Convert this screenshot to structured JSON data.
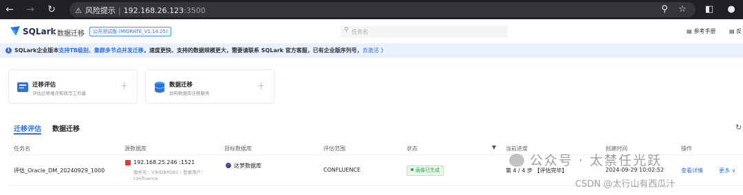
{
  "browser": {
    "security_label": "风险提示",
    "url_host": "192.168.26.123",
    "url_port": ":3500"
  },
  "header": {
    "logo_text": "SQLark",
    "module_title": "数据迁移",
    "version_badge": "公开测试版 (MIGRATE_V1.14.25)",
    "search_placeholder": "任务名",
    "ref_manual": "参考手册",
    "feedback": "反"
  },
  "notice": {
    "part1": "SQLark企业版本",
    "part2": "支持TB级别、集群多节点并发迁移",
    "part3": "，速度更快、支持的数据规模更大，需要请联系 SQLark 官方客服，已有企业版序列号，",
    "action": "去激活 》"
  },
  "cards": [
    {
      "title": "迁移评估",
      "subtitle": "评估迁移难点和改写工作量",
      "icon": "assessment-icon"
    },
    {
      "title": "数据迁移",
      "subtitle": "异构数据库迁移服务",
      "icon": "database-icon"
    }
  ],
  "tabs": [
    "迁移评估",
    "数据迁移"
  ],
  "table": {
    "columns": [
      "任务名",
      "源数据库",
      "目标数据库",
      "评估范围",
      "状态",
      "当前进度",
      "创建时间",
      "操作"
    ],
    "rows": [
      {
        "task_name": "评估_Oracle_DM_20240929_1000",
        "source_db": "192.168.25.246 :1521",
        "source_meta": "服务名：VIKIDBPDB1｜登录用户：",
        "source_user": "confluence",
        "target_db": "达梦数据库",
        "target_meta": "-",
        "scope": "CONFLUENCE",
        "status": "画像已生成",
        "progress": "第 4 / 4 步 【评估完毕】",
        "created": "2024-09-29 10:02:52",
        "action_view": "查看详情",
        "action_more": "更多 ∨"
      }
    ]
  },
  "watermark": {
    "line1": "公众号 · 太禁任光跃",
    "line2": "CSDN @太行山有西瓜汁"
  },
  "colors": {
    "accent": "#2f6fe6",
    "success": "#2a9d4b",
    "oracle": "#e03a2f",
    "chrome": "#202124"
  }
}
